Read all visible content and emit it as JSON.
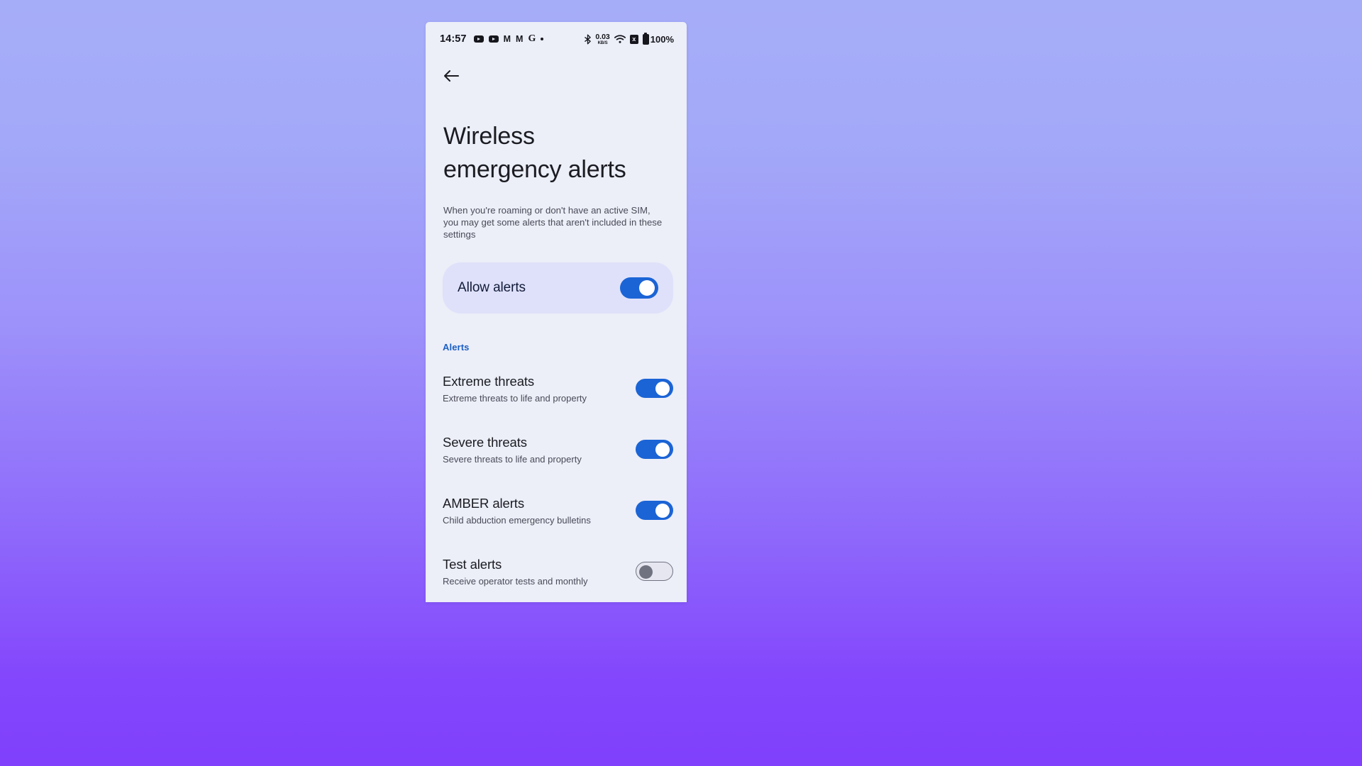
{
  "background": {
    "gradient_top": "#a6adf8",
    "gradient_bottom": "#8040fc"
  },
  "status_bar": {
    "clock": "14:57",
    "left_icons": [
      {
        "name": "youtube-icon",
        "glyph": "yt"
      },
      {
        "name": "youtube-icon",
        "glyph": "yt"
      },
      {
        "name": "gmail-icon",
        "glyph": "M"
      },
      {
        "name": "gmail-icon",
        "glyph": "M"
      },
      {
        "name": "google-icon",
        "glyph": "G"
      },
      {
        "name": "more-notifications-dot",
        "glyph": "dot"
      }
    ],
    "bluetooth_icon": "bluetooth-icon",
    "network_speed_value": "0.03",
    "network_speed_unit": "KB/S",
    "wifi_icon": "wifi-icon",
    "sim_icon_label": "x",
    "battery_percent": "100%"
  },
  "app_bar": {
    "back_label": "back-arrow"
  },
  "page": {
    "title": "Wireless emergency alerts",
    "description": "When you're roaming or don't have an active SIM, you may get some alerts that aren't included in these settings"
  },
  "allow_alerts": {
    "label": "Allow alerts",
    "enabled": true,
    "card_color": "#dfe1fa",
    "toggle_color": "#1b64d6"
  },
  "sections": [
    {
      "header": "Alerts",
      "header_color": "#1a5fc4",
      "items": [
        {
          "title": "Extreme threats",
          "subtitle": "Extreme threats to life and property",
          "enabled": true
        },
        {
          "title": "Severe threats",
          "subtitle": "Severe threats to life and property",
          "enabled": true
        },
        {
          "title": "AMBER alerts",
          "subtitle": "Child abduction emergency bulletins",
          "enabled": true
        },
        {
          "title": "Test alerts",
          "subtitle": "Receive operator tests and monthly",
          "enabled": false
        }
      ]
    }
  ]
}
